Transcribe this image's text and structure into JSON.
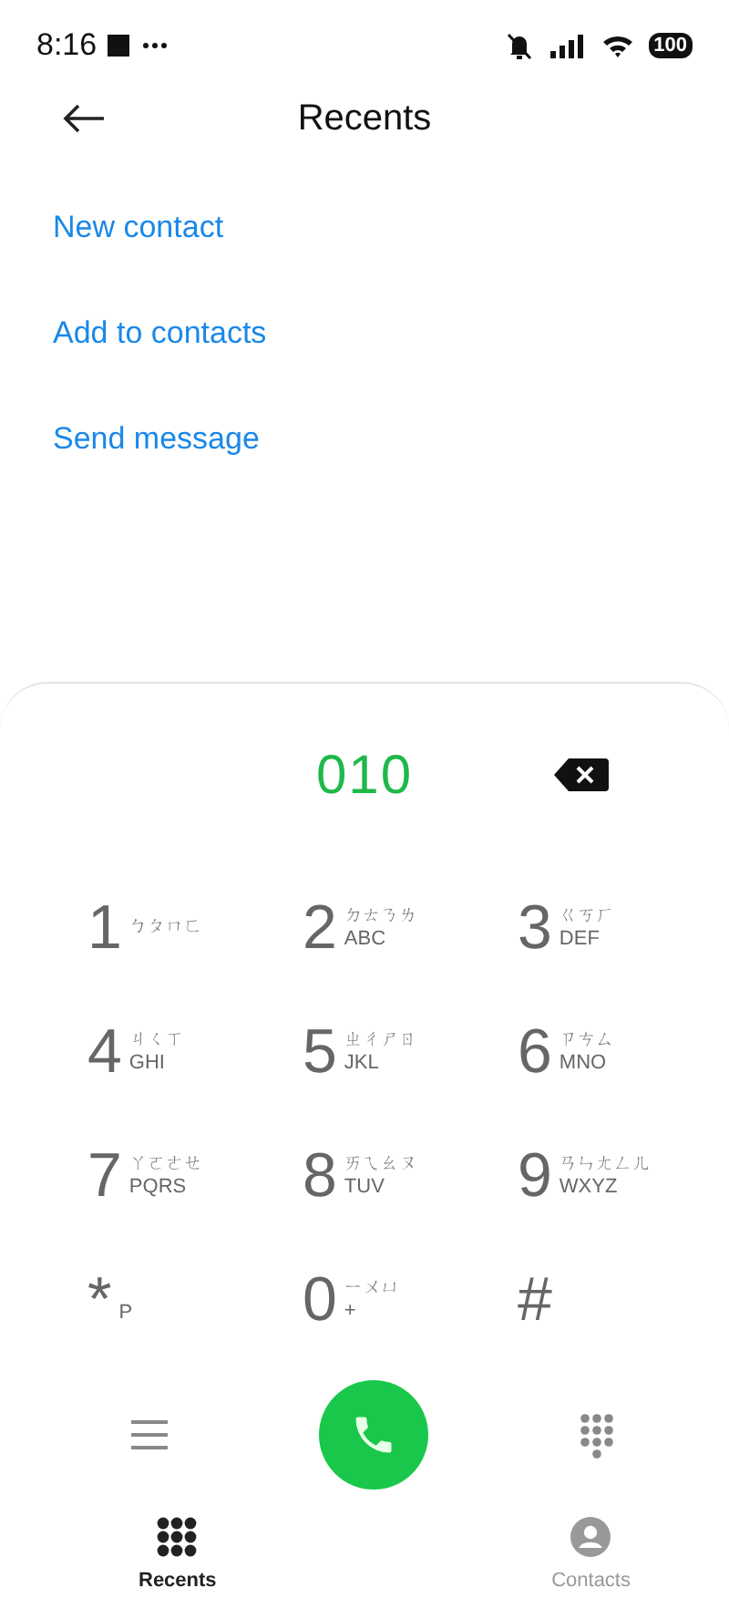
{
  "status_bar": {
    "time": "8:16",
    "battery": "100"
  },
  "header": {
    "title": "Recents"
  },
  "actions": [
    "New contact",
    "Add to contacts",
    "Send message"
  ],
  "dialpad": {
    "number": "010",
    "keys": [
      {
        "digit": "1",
        "zhuyin": "ㄅㄆㄇㄈ"
      },
      {
        "digit": "2",
        "zhuyin": "ㄉㄊㄋㄌ",
        "letters": "ABC"
      },
      {
        "digit": "3",
        "zhuyin": "ㄍㄎㄏ",
        "letters": "DEF"
      },
      {
        "digit": "4",
        "zhuyin": "ㄐㄑㄒ",
        "letters": "GHI"
      },
      {
        "digit": "5",
        "zhuyin": "ㄓㄔㄕㄖ",
        "letters": "JKL"
      },
      {
        "digit": "6",
        "zhuyin": "ㄗㄘㄙ",
        "letters": "MNO"
      },
      {
        "digit": "7",
        "zhuyin": "ㄚㄛㄜㄝ",
        "letters": "PQRS"
      },
      {
        "digit": "8",
        "zhuyin": "ㄞㄟㄠㄡ",
        "letters": "TUV"
      },
      {
        "digit": "9",
        "zhuyin": "ㄢㄣㄤㄥㄦ",
        "letters": "WXYZ"
      },
      {
        "digit": "*",
        "letters": "P"
      },
      {
        "digit": "0",
        "zhuyin": "ㄧㄨㄩ",
        "letters": "+"
      },
      {
        "digit": "#"
      }
    ]
  },
  "tabs": [
    {
      "label": "Recents",
      "selected": true
    },
    {
      "label": "Contacts",
      "selected": false
    }
  ]
}
